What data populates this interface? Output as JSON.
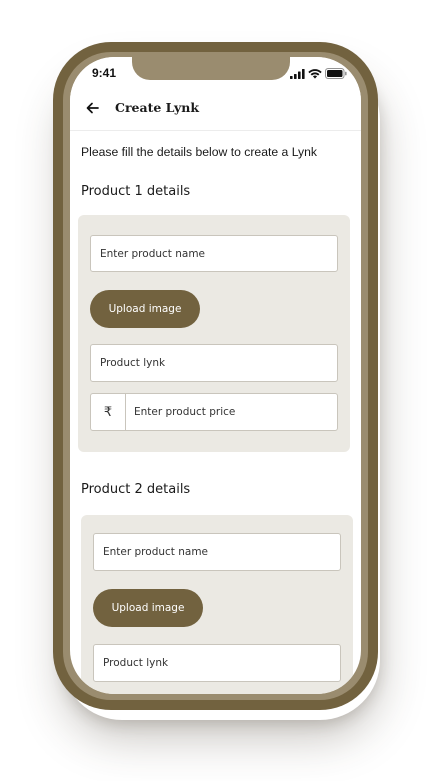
{
  "status_bar": {
    "time": "9:41",
    "signal_icon": "signal-icon",
    "wifi_icon": "wifi-icon",
    "battery_icon": "battery-icon"
  },
  "header": {
    "back_icon": "arrow-left-icon",
    "title": "Create Lynk"
  },
  "intro_text": "Please fill the details below to create a Lynk",
  "products": [
    {
      "title": "Product 1 details",
      "name_placeholder": "Enter product name",
      "upload_label": "Upload image",
      "lynk_placeholder": "Product lynk",
      "currency_symbol": "₹",
      "price_placeholder": "Enter product price"
    },
    {
      "title": "Product 2 details",
      "name_placeholder": "Enter product name",
      "upload_label": "Upload image",
      "lynk_placeholder": "Product lynk"
    }
  ],
  "colors": {
    "accent": "#72623f",
    "card_background": "#ebe9e3",
    "field_border": "#c9c5bc",
    "phone_frame": "#72623f"
  }
}
